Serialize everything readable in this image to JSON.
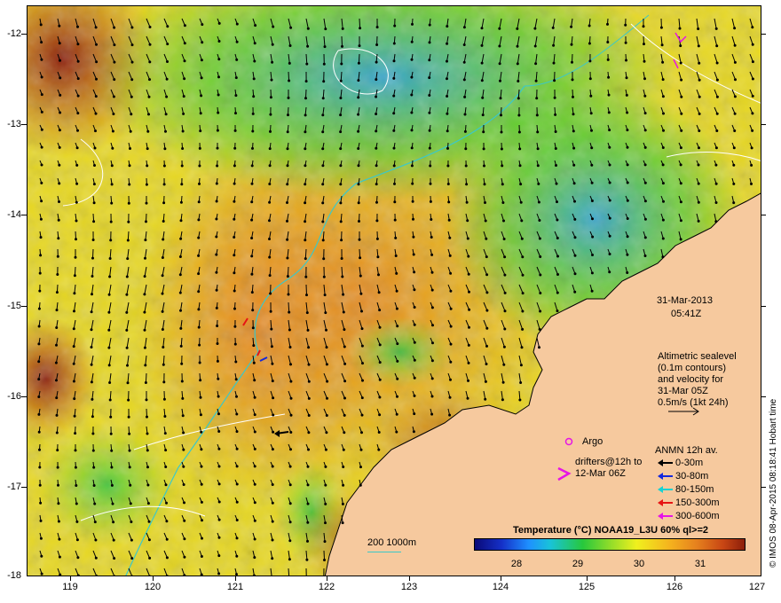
{
  "axes": {
    "y_ticks": [
      "-12",
      "-13",
      "-14",
      "-15",
      "-16",
      "-17",
      "-18"
    ],
    "x_ticks": [
      "119",
      "120",
      "121",
      "122",
      "123",
      "124",
      "125",
      "126",
      "127"
    ],
    "lon_range": [
      118.6,
      127.0
    ],
    "lat_range": [
      -18.0,
      -11.7
    ]
  },
  "annotation": {
    "date": "31-Mar-2013",
    "time": "05:41Z",
    "sealevel_lines": [
      "Altimetric sealevel",
      "(0.1m contours)",
      "and velocity for",
      "31-Mar 05Z",
      "0.5m/s (1kt 24h)"
    ]
  },
  "legend": {
    "argo_label": "Argo",
    "drifter_lines": [
      "drifters@12h to",
      "12-Mar 06Z"
    ],
    "anmn_title": "ANMN 12h av.",
    "anmn_items": [
      {
        "label": "0-30m",
        "color": "#000000"
      },
      {
        "label": "30-80m",
        "color": "#1428dc"
      },
      {
        "label": "80-150m",
        "color": "#19d2d2"
      },
      {
        "label": "150-300m",
        "color": "#e61414"
      },
      {
        "label": "300-600m",
        "color": "#e614e6"
      }
    ]
  },
  "isobath_key": "200  1000m",
  "colorbar": {
    "title": "Temperature (°C) NOAA19_L3U 60% ql>=2",
    "ticks": [
      "28",
      "29",
      "30",
      "31"
    ],
    "range": [
      27.0,
      31.8
    ]
  },
  "credit": "© IMOS 08-Apr-2015 08:18:41 Hobart time",
  "colors": {
    "land": "#f6c99e",
    "argo": "#e614e6",
    "isobath": "#3cc8c8",
    "sealevel_contour": "#ffffff"
  }
}
